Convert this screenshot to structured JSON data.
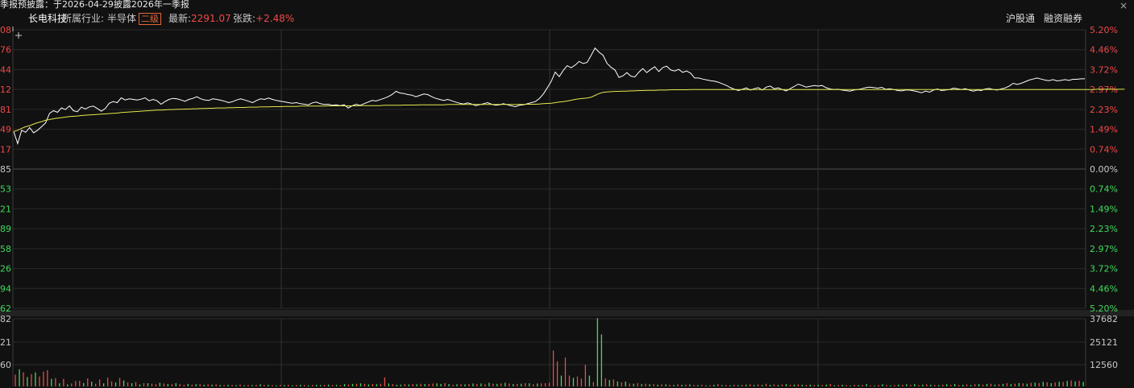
{
  "ticker_text": "季报预披露：于2026-04-29披露2026年一季报",
  "close_glyph": "×",
  "header": {
    "stock_name": "长电科技",
    "industry_label": "所属行业:",
    "industry": "半导体",
    "level_badge": "二级",
    "latest_label": "最新:",
    "latest_value": "2291.07",
    "change_label": "张跌:",
    "change_value": "+2.48%",
    "link_hk": "沪股通",
    "link_margin": "融资融券"
  },
  "colors": {
    "background": "#111111",
    "grid": "#2a2a2a",
    "grid_dark": "#333333",
    "up_red": "#f04848",
    "down_green": "#3ddc5c",
    "price_line": "#ffffff",
    "avg_line": "#e6e64c",
    "volume_up": "#e84a4a",
    "volume_down": "#3ddc5c"
  },
  "chart_data": {
    "type": "line",
    "series": [
      {
        "values": [
          1.4,
          0.95,
          1.45,
          1.37,
          1.55,
          1.35,
          1.45,
          1.58,
          1.72,
          2.08,
          2.18,
          2.12,
          2.28,
          2.22,
          2.36,
          2.18,
          2.14,
          2.31,
          2.24,
          2.32,
          2.35,
          2.26,
          2.16,
          2.26,
          2.46,
          2.52,
          2.48,
          2.66,
          2.58,
          2.62,
          2.6,
          2.58,
          2.61,
          2.66,
          2.55,
          2.6,
          2.55,
          2.42,
          2.52,
          2.6,
          2.64,
          2.62,
          2.58,
          2.53,
          2.6,
          2.64,
          2.7,
          2.62,
          2.58,
          2.56,
          2.62,
          2.6,
          2.57,
          2.53,
          2.48,
          2.52,
          2.58,
          2.62,
          2.58,
          2.53,
          2.48,
          2.56,
          2.62,
          2.6,
          2.65,
          2.6,
          2.56,
          2.53,
          2.51,
          2.48,
          2.46,
          2.48,
          2.44,
          2.42,
          2.4,
          2.47,
          2.5,
          2.44,
          2.41,
          2.42,
          2.38,
          2.4,
          2.37,
          2.4,
          2.28,
          2.36,
          2.42,
          2.38,
          2.44,
          2.5,
          2.56,
          2.54,
          2.59,
          2.64,
          2.7,
          2.78,
          2.9,
          2.84,
          2.82,
          2.78,
          2.76,
          2.7,
          2.75,
          2.8,
          2.78,
          2.7,
          2.64,
          2.6,
          2.56,
          2.6,
          2.55,
          2.5,
          2.46,
          2.43,
          2.47,
          2.43,
          2.37,
          2.4,
          2.44,
          2.48,
          2.42,
          2.38,
          2.4,
          2.44,
          2.4,
          2.36,
          2.33,
          2.38,
          2.4,
          2.44,
          2.48,
          2.52,
          2.63,
          2.8,
          3.03,
          3.28,
          3.62,
          3.45,
          3.68,
          3.86,
          3.78,
          3.88,
          4.02,
          3.94,
          3.98,
          4.24,
          4.52,
          4.36,
          4.25,
          3.95,
          3.8,
          3.7,
          3.42,
          3.48,
          3.6,
          3.47,
          3.44,
          3.62,
          3.75,
          3.6,
          3.72,
          3.82,
          3.64,
          3.79,
          3.84,
          3.7,
          3.66,
          3.72,
          3.61,
          3.66,
          3.58,
          3.4,
          3.4,
          3.36,
          3.33,
          3.3,
          3.28,
          3.24,
          3.18,
          3.12,
          3.04,
          2.98,
          2.93,
          2.98,
          3.03,
          2.95,
          3.0,
          3.04,
          2.95,
          3.06,
          3.1,
          3.0,
          3.03,
          2.97,
          2.92,
          3.0,
          3.08,
          3.17,
          3.12,
          3.06,
          3.09,
          3.12,
          3.1,
          3.12,
          3.04,
          2.99,
          2.97,
          2.98,
          2.95,
          2.93,
          2.91,
          2.95,
          2.97,
          3.0,
          3.04,
          3.06,
          3.04,
          3.02,
          3.05,
          2.98,
          3.0,
          2.97,
          2.93,
          2.92,
          2.95,
          2.95,
          2.92,
          2.89,
          2.85,
          2.91,
          2.87,
          2.95,
          2.99,
          2.93,
          2.95,
          2.97,
          3.02,
          3.0,
          2.97,
          3.0,
          2.95,
          2.91,
          2.95,
          2.93,
          2.99,
          3.01,
          2.97,
          2.95,
          2.99,
          3.03,
          3.1,
          3.2,
          3.16,
          3.2,
          3.26,
          3.32,
          3.36,
          3.4,
          3.36,
          3.32,
          3.3,
          3.34,
          3.29,
          3.31,
          3.34,
          3.31,
          3.35,
          3.35,
          3.37,
          3.37
        ]
      },
      {
        "values": [
          1.4,
          1.45,
          1.52,
          1.58,
          1.62,
          1.68,
          1.73,
          1.77,
          1.82,
          1.85,
          1.88,
          1.9,
          1.92,
          1.94,
          1.96,
          1.97,
          1.98,
          2.0,
          2.01,
          2.02,
          2.03,
          2.04,
          2.05,
          2.06,
          2.07,
          2.08,
          2.09,
          2.11,
          2.12,
          2.13,
          2.14,
          2.15,
          2.16,
          2.17,
          2.18,
          2.19,
          2.2,
          2.2,
          2.21,
          2.22,
          2.22,
          2.23,
          2.23,
          2.24,
          2.24,
          2.25,
          2.25,
          2.26,
          2.26,
          2.27,
          2.27,
          2.28,
          2.28,
          2.28,
          2.29,
          2.29,
          2.3,
          2.3,
          2.3,
          2.31,
          2.31,
          2.31,
          2.32,
          2.32,
          2.32,
          2.33,
          2.33,
          2.33,
          2.34,
          2.34,
          2.34,
          2.34,
          2.35,
          2.35,
          2.35,
          2.35,
          2.35,
          2.35,
          2.35,
          2.36,
          2.36,
          2.36,
          2.36,
          2.36,
          2.36,
          2.36,
          2.36,
          2.37,
          2.37,
          2.37,
          2.37,
          2.37,
          2.37,
          2.38,
          2.38,
          2.38,
          2.38,
          2.38,
          2.39,
          2.39,
          2.39,
          2.39,
          2.4,
          2.4,
          2.4,
          2.4,
          2.4,
          2.4,
          2.4,
          2.41,
          2.41,
          2.41,
          2.41,
          2.41,
          2.41,
          2.41,
          2.41,
          2.41,
          2.41,
          2.41,
          2.41,
          2.41,
          2.41,
          2.41,
          2.41,
          2.41,
          2.41,
          2.41,
          2.41,
          2.42,
          2.42,
          2.42,
          2.43,
          2.44,
          2.45,
          2.46,
          2.48,
          2.5,
          2.52,
          2.54,
          2.57,
          2.6,
          2.62,
          2.64,
          2.65,
          2.68,
          2.75,
          2.82,
          2.86,
          2.88,
          2.89,
          2.9,
          2.9,
          2.91,
          2.91,
          2.92,
          2.92,
          2.93,
          2.93,
          2.94,
          2.94,
          2.94,
          2.95,
          2.95,
          2.95,
          2.96,
          2.96,
          2.96,
          2.96,
          2.96,
          2.97,
          2.97,
          2.97,
          2.97,
          2.97,
          2.97,
          2.97,
          2.97,
          2.97,
          2.97,
          2.97,
          2.97,
          2.97,
          2.97,
          2.97,
          2.97,
          2.97,
          2.97,
          2.97,
          2.97,
          2.97,
          2.97,
          2.97,
          2.97,
          2.97,
          2.97,
          2.97,
          2.97,
          2.97,
          2.97,
          2.97,
          2.97,
          2.97,
          2.97,
          2.97,
          2.97,
          2.97,
          2.97,
          2.97,
          2.97,
          2.97,
          2.97,
          2.97,
          2.97,
          2.97,
          2.97,
          2.97,
          2.97,
          2.97,
          2.97,
          2.97,
          2.97,
          2.97,
          2.97,
          2.97,
          2.97,
          2.97,
          2.97,
          2.97,
          2.97,
          2.97,
          2.97,
          2.97,
          2.97,
          2.97,
          2.97,
          2.97,
          2.97,
          2.97,
          2.97,
          2.97,
          2.97,
          2.97,
          2.97,
          2.97,
          2.97,
          2.97,
          2.97,
          2.97,
          2.97,
          2.97,
          2.97,
          2.97,
          2.97,
          2.97,
          2.97,
          2.97,
          2.97,
          2.97,
          2.97,
          2.97,
          2.97,
          2.97,
          2.97,
          2.97,
          2.97,
          2.97,
          2.97,
          2.97,
          2.97,
          2.97,
          2.97,
          2.98,
          2.98,
          2.98,
          2.98,
          2.98,
          2.98,
          2.98,
          2.98
        ]
      }
    ],
    "ylim": [
      -5.2,
      5.2
    ],
    "left_tick_labels": [
      "08",
      "76",
      "44",
      "12",
      "81",
      "49",
      "17",
      "85",
      "53",
      "21",
      "89",
      "58",
      "26",
      "94",
      "62"
    ],
    "right_tick_labels": [
      "5.20%",
      "4.46%",
      "3.72%",
      "2.97%",
      "2.23%",
      "1.49%",
      "0.74%",
      "0.00%",
      "0.74%",
      "1.49%",
      "2.23%",
      "2.97%",
      "3.72%",
      "4.46%",
      "5.20%"
    ],
    "volume": {
      "max": 37682,
      "left_tick_labels": [
        "82",
        "21",
        "60"
      ],
      "right_tick_labels": [
        "37682",
        "25121",
        "12560"
      ],
      "values": [
        6500,
        9500,
        7800,
        5200,
        6800,
        7800,
        5500,
        8200,
        9000,
        4200,
        4600,
        1700,
        4200,
        1100,
        1600,
        3000,
        3100,
        1900,
        4500,
        2600,
        1500,
        3800,
        1700,
        4900,
        2800,
        2200,
        4700,
        3300,
        2200,
        1800,
        2400,
        1100,
        1800,
        1800,
        1500,
        1200,
        2000,
        1600,
        1300,
        1200,
        1800,
        1300,
        900,
        1400,
        1000,
        1200,
        1300,
        900,
        1100,
        1000,
        1100,
        800,
        700,
        900,
        800,
        700,
        1100,
        600,
        800,
        700,
        900,
        1200,
        800,
        900,
        700,
        600,
        800,
        700,
        900,
        600,
        800,
        900,
        700,
        600,
        800,
        900,
        700,
        800,
        1000,
        700,
        800,
        600,
        1300,
        1100,
        1400,
        1500,
        1700,
        1400,
        1100,
        1300,
        1200,
        1500,
        5000,
        1600,
        1300,
        900,
        1000,
        1300,
        1100,
        1300,
        1200,
        1500,
        1300,
        1400,
        1600,
        1700,
        1400,
        1800,
        1300,
        900,
        1200,
        1300,
        1100,
        1400,
        1600,
        1300,
        1600,
        1200,
        2000,
        1500,
        1400,
        1700,
        2000,
        1600,
        1300,
        1400,
        1500,
        1800,
        1700,
        1200,
        1600,
        1700,
        1800,
        2000,
        20000,
        14000,
        6000,
        16000,
        6000,
        4800,
        5500,
        4300,
        12000,
        6000,
        2400,
        38000,
        29000,
        4500,
        3600,
        3900,
        2800,
        2300,
        2700,
        1600,
        1500,
        1800,
        1300,
        1500,
        1200,
        1300,
        1000,
        1100,
        1100,
        900,
        800,
        1200,
        900,
        1000,
        1100,
        800,
        700,
        900,
        600,
        700,
        900,
        1300,
        700,
        800,
        600,
        900,
        700,
        900,
        1000,
        1200,
        800,
        1100,
        800,
        1500,
        900,
        1100,
        800,
        1100,
        1300,
        900,
        1000,
        1100,
        900,
        800,
        1000,
        700,
        900,
        800,
        1000,
        1400,
        600,
        800,
        900,
        700,
        500,
        900,
        700,
        800,
        1300,
        600,
        500,
        800,
        1200,
        800,
        600,
        700,
        1000,
        900,
        1200,
        800,
        1300,
        700,
        1000,
        1200,
        900,
        800,
        700,
        1000,
        1200,
        900,
        1400,
        800,
        900,
        1100,
        800,
        1200,
        1300,
        1000,
        1400,
        1500,
        1000,
        1200,
        1400,
        1800,
        1300,
        1500,
        1900,
        1700,
        1500,
        2000,
        2100,
        1900,
        2500,
        2300,
        1800,
        2200,
        2600,
        2400,
        3100,
        3300,
        2800,
        3200,
        2500
      ],
      "up_flags": [
        1,
        0,
        1,
        0,
        1,
        0,
        1,
        1,
        1,
        0,
        1,
        0,
        1,
        0,
        1,
        1,
        1,
        0,
        1,
        0,
        1,
        1,
        0,
        1,
        1,
        0,
        1,
        0,
        1,
        0,
        1,
        0,
        1,
        0,
        1,
        1,
        0,
        1,
        0,
        1,
        0,
        1,
        1,
        0,
        1,
        0,
        1,
        0,
        1,
        0,
        1,
        0,
        1,
        0,
        1,
        0,
        1,
        0,
        1,
        0,
        1,
        0,
        1,
        0,
        1,
        0,
        1,
        0,
        1,
        0,
        1,
        0,
        1,
        0,
        1,
        0,
        0,
        1,
        0,
        1,
        0,
        1,
        0,
        1,
        0,
        1,
        0,
        1,
        0,
        1,
        0,
        1,
        1,
        0,
        1,
        0,
        0,
        1,
        0,
        1,
        0,
        1,
        0,
        1,
        1,
        0,
        0,
        1,
        0,
        1,
        0,
        1,
        0,
        1,
        0,
        1,
        0,
        1,
        0,
        1,
        0,
        1,
        0,
        1,
        0,
        1,
        0,
        1,
        0,
        1,
        0,
        1,
        1,
        1,
        1,
        1,
        0,
        1,
        1,
        0,
        1,
        1,
        1,
        0,
        1,
        0,
        0,
        1,
        0,
        1,
        0,
        1,
        0,
        1,
        0,
        1,
        0,
        1,
        0,
        1,
        0,
        1,
        0,
        1,
        0,
        1,
        0,
        1,
        0,
        1,
        0,
        1,
        0,
        1,
        0,
        1,
        0,
        1,
        0,
        1,
        0,
        1,
        0,
        1,
        0,
        1,
        0,
        1,
        0,
        1,
        0,
        1,
        0,
        1,
        0,
        1,
        0,
        1,
        0,
        1,
        0,
        1,
        0,
        1,
        0,
        1,
        0,
        1,
        0,
        1,
        0,
        1,
        0,
        1,
        0,
        1,
        0,
        1,
        0,
        1,
        0,
        1,
        0,
        1,
        0,
        1,
        0,
        1,
        0,
        1,
        0,
        1,
        0,
        1,
        0,
        1,
        0,
        1,
        0,
        1,
        0,
        1,
        0,
        1,
        0,
        1,
        0,
        1,
        0,
        1,
        0,
        1,
        0,
        1,
        0,
        1,
        0,
        1,
        0,
        1,
        0,
        1,
        0,
        1,
        0,
        1,
        0,
        1,
        0,
        1,
        0,
        1,
        1,
        0,
        1
      ]
    }
  }
}
